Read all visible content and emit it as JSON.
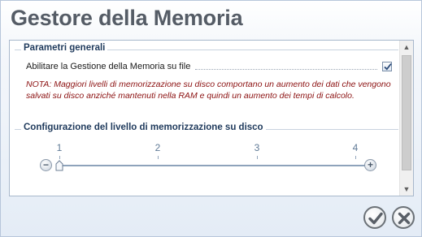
{
  "dialog": {
    "title": "Gestore della Memoria"
  },
  "general": {
    "title": "Parametri generali",
    "enable_label": "Abilitare la Gestione della Memoria su file",
    "enable_checked": true,
    "note": "NOTA: Maggiori livelli di memorizzazione su disco comportano un aumento dei dati che vengono salvati su disco anziché mantenuti nella RAM e quindi un aumento dei tempi di calcolo."
  },
  "disk_level": {
    "title": "Configurazione del livello di memorizzazione su disco",
    "ticks": [
      "1",
      "2",
      "3",
      "4"
    ],
    "value": 1,
    "decrease_icon": "minus-icon",
    "increase_icon": "plus-icon"
  },
  "footer": {
    "ok_icon": "checkmark-icon",
    "cancel_icon": "x-icon"
  },
  "colors": {
    "note_text": "#8b1010",
    "group_title": "#1f3a5c",
    "title_text": "#555c66"
  }
}
